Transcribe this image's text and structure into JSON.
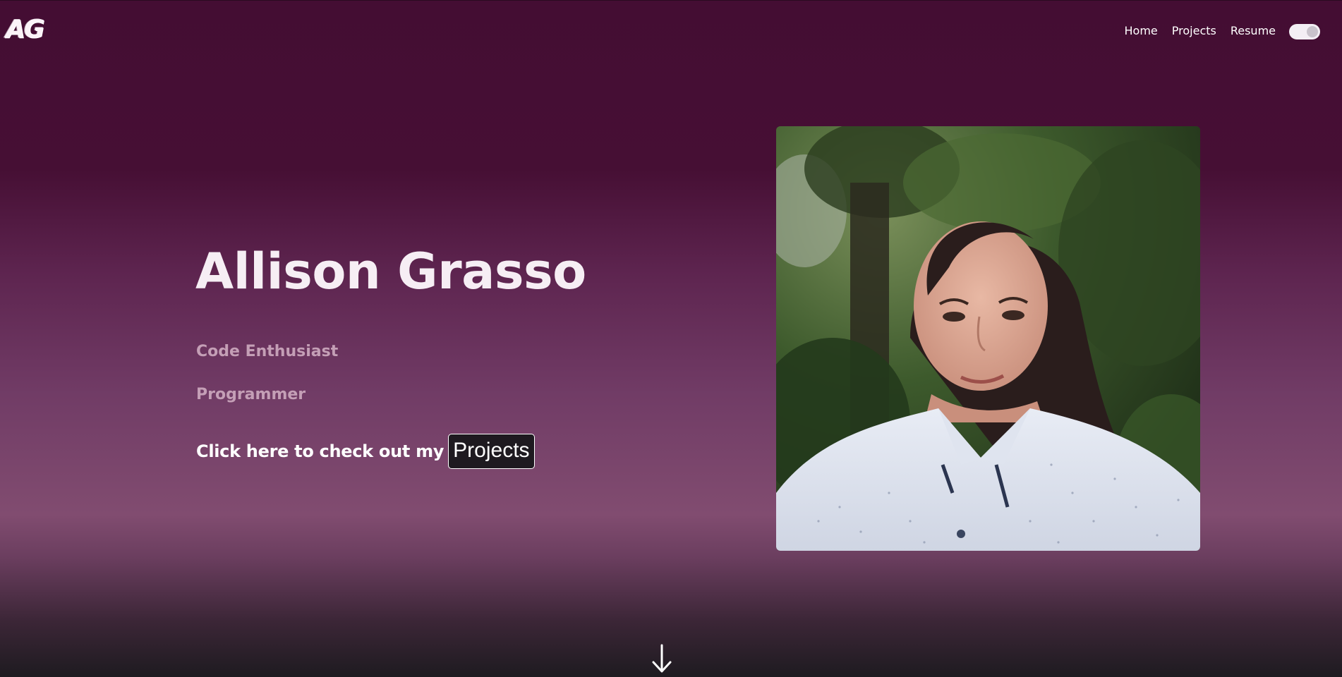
{
  "header": {
    "logo_text": "AG",
    "nav": [
      {
        "label": "Home"
      },
      {
        "label": "Projects"
      },
      {
        "label": "Resume"
      }
    ],
    "theme_toggle": {
      "state": "on"
    }
  },
  "hero": {
    "name": "Allison Grasso",
    "roles": [
      "Code Enthusiast",
      "Programmer"
    ],
    "cta_text": "Click here to check out my",
    "cta_button": "Projects"
  },
  "icons": {
    "scroll": "arrow-down-icon",
    "toggle": "theme-toggle-icon"
  },
  "colors": {
    "background_top": "#440d33",
    "background_mid": "#814c70",
    "background_bottom": "#1e1b20",
    "role_text": "#c49fb6",
    "button_bg": "#1e1a20"
  }
}
